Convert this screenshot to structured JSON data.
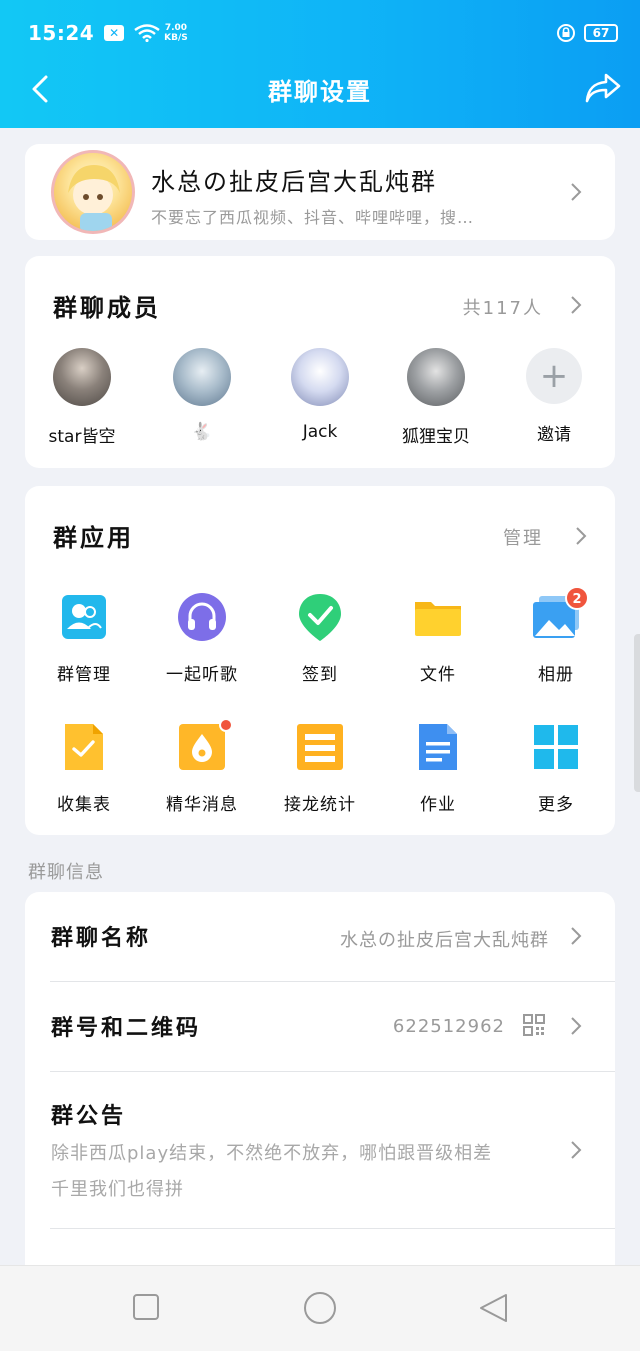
{
  "status_bar": {
    "time": "15:24",
    "speed_value": "7.00",
    "speed_unit": "KB/S",
    "battery": "67"
  },
  "header": {
    "title": "群聊设置"
  },
  "group": {
    "name": "水总の扯皮后宫大乱炖群",
    "description": "不要忘了西瓜视频、抖音、哔哩哔哩，搜…"
  },
  "members": {
    "title": "群聊成员",
    "count_text": "共117人",
    "items": [
      {
        "name": "star皆空",
        "color": "#6b6660"
      },
      {
        "name": "🐇",
        "color": "#8fa6b7"
      },
      {
        "name": "Jack",
        "color": "#c9d2ea"
      },
      {
        "name": "狐狸宝贝",
        "color": "#8d8f92"
      }
    ],
    "invite_label": "邀请"
  },
  "apps": {
    "title": "群应用",
    "manage_label": "管理",
    "items": [
      {
        "label": "群管理",
        "icon": "group-manage-icon"
      },
      {
        "label": "一起听歌",
        "icon": "headphones-icon"
      },
      {
        "label": "签到",
        "icon": "checkin-icon"
      },
      {
        "label": "文件",
        "icon": "folder-icon"
      },
      {
        "label": "相册",
        "icon": "album-icon",
        "badge": "2"
      },
      {
        "label": "收集表",
        "icon": "collect-form-icon"
      },
      {
        "label": "精华消息",
        "icon": "essence-icon",
        "dot": true
      },
      {
        "label": "接龙统计",
        "icon": "chain-stats-icon"
      },
      {
        "label": "作业",
        "icon": "homework-icon"
      },
      {
        "label": "更多",
        "icon": "more-grid-icon"
      }
    ]
  },
  "info": {
    "heading": "群聊信息",
    "name_label": "群聊名称",
    "name_value": "水总の扯皮后宫大乱炖群",
    "number_label": "群号和二维码",
    "number_value": "622512962",
    "notice_label": "群公告",
    "notice_line1": "除非西瓜play结束，不然绝不放弃，哪怕跟晋级相差",
    "notice_line2": "千里我们也得拼"
  },
  "colors": {
    "accent": "#12b8f6",
    "badge": "#f0553d"
  }
}
